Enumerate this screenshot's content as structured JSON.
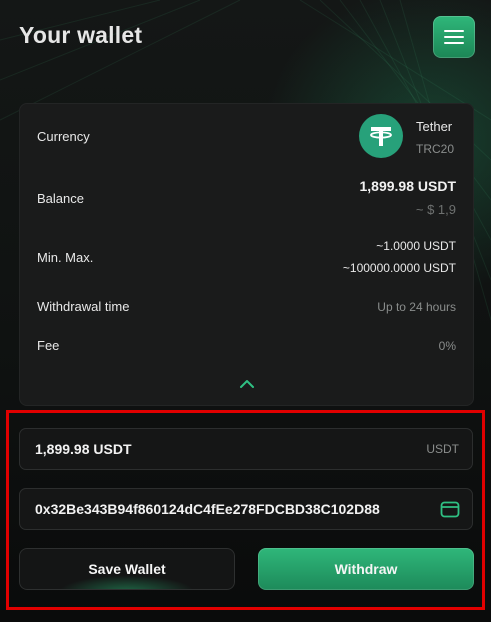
{
  "header": {
    "title": "Your wallet",
    "menu_icon": "hamburger-menu-icon"
  },
  "details": {
    "currency": {
      "label": "Currency",
      "name": "Tether",
      "network": "TRC20",
      "icon": "tether-logo-icon"
    },
    "balance": {
      "label": "Balance",
      "value": "1,899.98 USDT",
      "approx": "~ $ 1,9"
    },
    "limits": {
      "label": "Min. Max.",
      "min": "~1.0000 USDT",
      "max": "~100000.0000 USDT"
    },
    "withdrawal_time": {
      "label": "Withdrawal time",
      "value": "Up to 24 hours"
    },
    "fee": {
      "label": "Fee",
      "value": "0%"
    },
    "collapse_icon": "chevron-up-icon"
  },
  "form": {
    "amount": {
      "value": "1,899.98 USDT",
      "unit": "USDT"
    },
    "address": {
      "value": "0x32Be343B94f860124dC4fEe278FDCBD38C102D88",
      "icon": "wallet-icon"
    },
    "save_label": "Save Wallet",
    "withdraw_label": "Withdraw"
  },
  "colors": {
    "accent": "#27a36f",
    "highlight": "#e00000",
    "tether": "#27a17a"
  }
}
